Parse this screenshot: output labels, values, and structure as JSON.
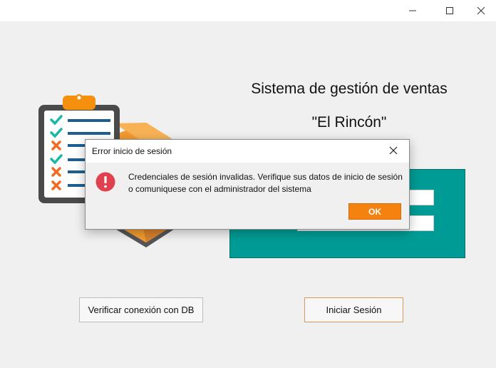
{
  "window": {
    "minimize_icon": "minimize-icon",
    "maximize_icon": "maximize-icon",
    "close_icon": "close-icon"
  },
  "header": {
    "title": "Sistema de gestión de ventas",
    "subtitle": "\"El Rincón\""
  },
  "login": {
    "username_value": "",
    "password_value": ""
  },
  "buttons": {
    "verify_db": "Verificar conexión con DB",
    "login": "Iniciar Sesión"
  },
  "dialog": {
    "title": "Error inicio de sesión",
    "message": "Credenciales de sesión invalidas. Verifique sus datos de inicio de sesión o comuniquese con el administrador del sistema",
    "ok_label": "OK",
    "icon": "error-icon"
  },
  "colors": {
    "accent_teal": "#009b94",
    "ok_orange": "#f5820f",
    "error_red": "#e0414f",
    "check_teal": "#17b8a6",
    "cross_orange": "#f26b21"
  }
}
